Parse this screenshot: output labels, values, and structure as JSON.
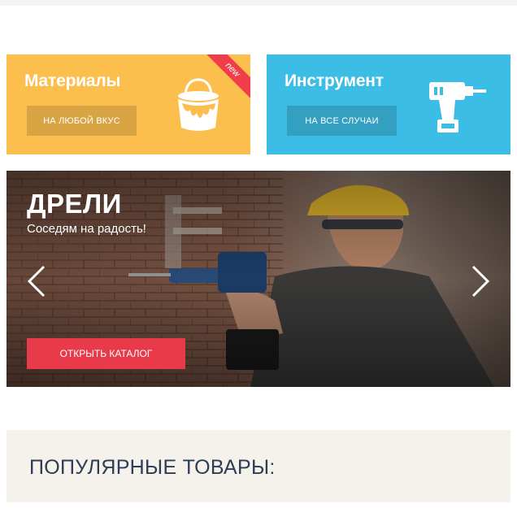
{
  "colors": {
    "materials_bg": "#fcbe4c",
    "materials_btn": "#d9a544",
    "tools_bg": "#3cbde6",
    "tools_btn": "#34a0c1",
    "ribbon": "#ef3e4a",
    "slide_btn": "#e93a4a",
    "popular_bg": "#f5f2ec",
    "popular_text": "#2e3d55"
  },
  "promo": {
    "materials": {
      "title": "Материалы",
      "button": "На любой вкус",
      "badge": "new",
      "icon": "paint-bucket-icon"
    },
    "tools": {
      "title": "Инструмент",
      "button": "На все случаи",
      "icon": "drill-icon"
    }
  },
  "slider": {
    "title": "ДРЕЛИ",
    "subtitle": "Соседям на радость!",
    "button": "Открыть каталог",
    "prev_icon": "chevron-left-icon",
    "next_icon": "chevron-right-icon"
  },
  "popular": {
    "title": "Популярные товары:"
  }
}
